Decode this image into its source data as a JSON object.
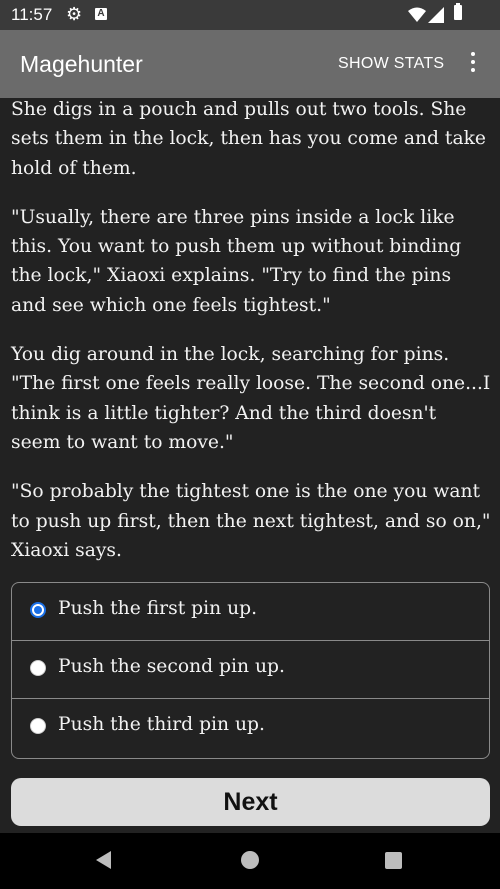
{
  "status_bar": {
    "time": "11:57",
    "icons": [
      "gear-icon",
      "a-icon",
      "wifi-icon",
      "signal-icon",
      "battery-icon"
    ]
  },
  "app_bar": {
    "title": "Magehunter",
    "show_stats_label": "SHOW STATS",
    "menu_icon": "more-vert-icon"
  },
  "story": {
    "paragraphs": [
      "She digs in a pouch and pulls out two tools. She sets them in the lock, then has you come and take hold of them.",
      "\"Usually, there are three pins inside a lock like this. You want to push them up without binding the lock,\" Xiaoxi explains. \"Try to find the pins and see which one feels tightest.\"",
      "You dig around in the lock, searching for pins. \"The first one feels really loose. The second one...I think is a little tighter? And the third doesn't seem to want to move.\"",
      "\"So probably the tightest one is the one you want to push up first, then the next tightest, and so on,\" Xiaoxi says."
    ]
  },
  "choices": {
    "selected_index": 0,
    "options": [
      "Push the first pin up.",
      "Push the second pin up.",
      "Push the third pin up."
    ]
  },
  "next_button": {
    "label": "Next"
  },
  "colors": {
    "background": "#222222",
    "app_bar": "#6b6b6b",
    "radio_selected": "#1a6fe6",
    "button": "#dcdcdc"
  }
}
